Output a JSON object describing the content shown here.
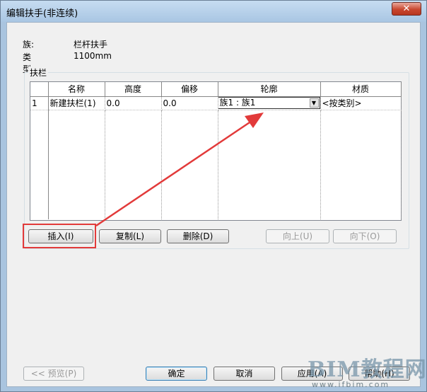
{
  "window": {
    "title": "编辑扶手(非连续)",
    "close": "✕"
  },
  "info": {
    "family_label": "族:",
    "family_value": "栏杆扶手",
    "type_label": "类型:",
    "type_value": "1100mm"
  },
  "group": {
    "label": "扶栏"
  },
  "table": {
    "columns": [
      "名称",
      "高度",
      "偏移",
      "轮廓",
      "材质"
    ],
    "rows": [
      {
        "num": "1",
        "name": "新建扶栏(1)",
        "height": "0.0",
        "offset": "0.0",
        "profile": "族1 : 族1",
        "material": "<按类别>"
      }
    ]
  },
  "row_buttons": {
    "insert": "插入(I)",
    "copy": "复制(L)",
    "delete": "删除(D)",
    "up": "向上(U)",
    "down": "向下(O)"
  },
  "footer_buttons": {
    "preview": "<< 预览(P)",
    "ok": "确定",
    "cancel": "取消",
    "apply": "应用(A)",
    "help": "帮助(H)"
  },
  "watermark": {
    "text": "BIM教程网",
    "url": "www.ifbim.com"
  },
  "colors": {
    "annotation": "#e23a3a"
  }
}
